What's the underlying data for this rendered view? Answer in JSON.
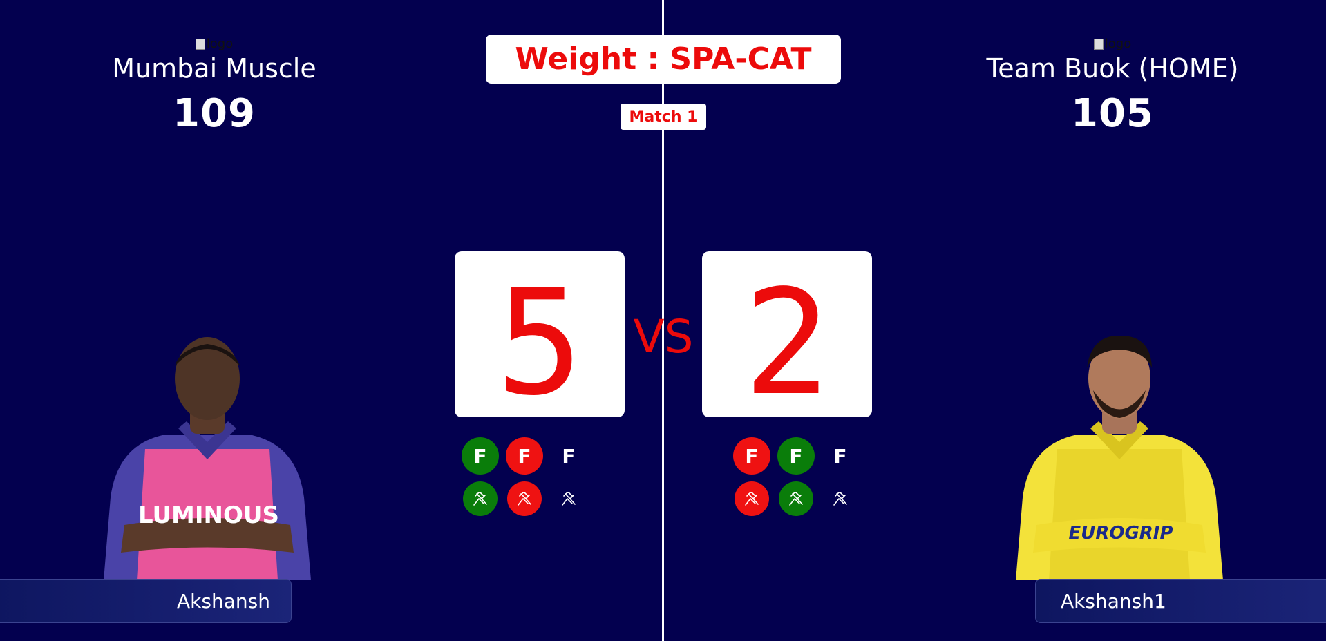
{
  "left_team": {
    "logo_alt": "logo",
    "name": "Mumbai Muscle",
    "score": "109",
    "points": "5",
    "player_name": "Akshansh",
    "jersey_text": "LUMINOUS",
    "colors": {
      "jersey": "#e8559a",
      "sleeve": "#4a43a8"
    }
  },
  "right_team": {
    "logo_alt": "logo",
    "name": "Team Buok (HOME)",
    "score": "105",
    "points": "2",
    "player_name": "Akshansh1",
    "jersey_text": "EUROGRIP",
    "colors": {
      "jersey": "#f3e23a",
      "sleeve": "#e9d52b"
    }
  },
  "header": {
    "weight_label": "Weight : SPA-CAT",
    "match_label": "Match 1"
  },
  "vs_label": "VS",
  "indicators": {
    "left": {
      "foul_row": [
        {
          "label": "F",
          "status": "green"
        },
        {
          "label": "F",
          "status": "red"
        },
        {
          "label": "F",
          "status": "none"
        }
      ],
      "hand_row": [
        {
          "icon": "arm-wrestle-icon",
          "status": "green"
        },
        {
          "icon": "arm-wrestle-icon",
          "status": "red"
        },
        {
          "icon": "arm-wrestle-icon",
          "status": "none"
        }
      ]
    },
    "right": {
      "foul_row": [
        {
          "label": "F",
          "status": "red"
        },
        {
          "label": "F",
          "status": "green"
        },
        {
          "label": "F",
          "status": "none"
        }
      ],
      "hand_row": [
        {
          "icon": "arm-wrestle-icon",
          "status": "red"
        },
        {
          "icon": "arm-wrestle-icon",
          "status": "green"
        },
        {
          "icon": "arm-wrestle-icon",
          "status": "none"
        }
      ]
    }
  },
  "colors": {
    "background": "#03004f",
    "accent_red": "#ec0b0b",
    "status_green": "#0a7d0a",
    "status_red": "#ef1212"
  }
}
